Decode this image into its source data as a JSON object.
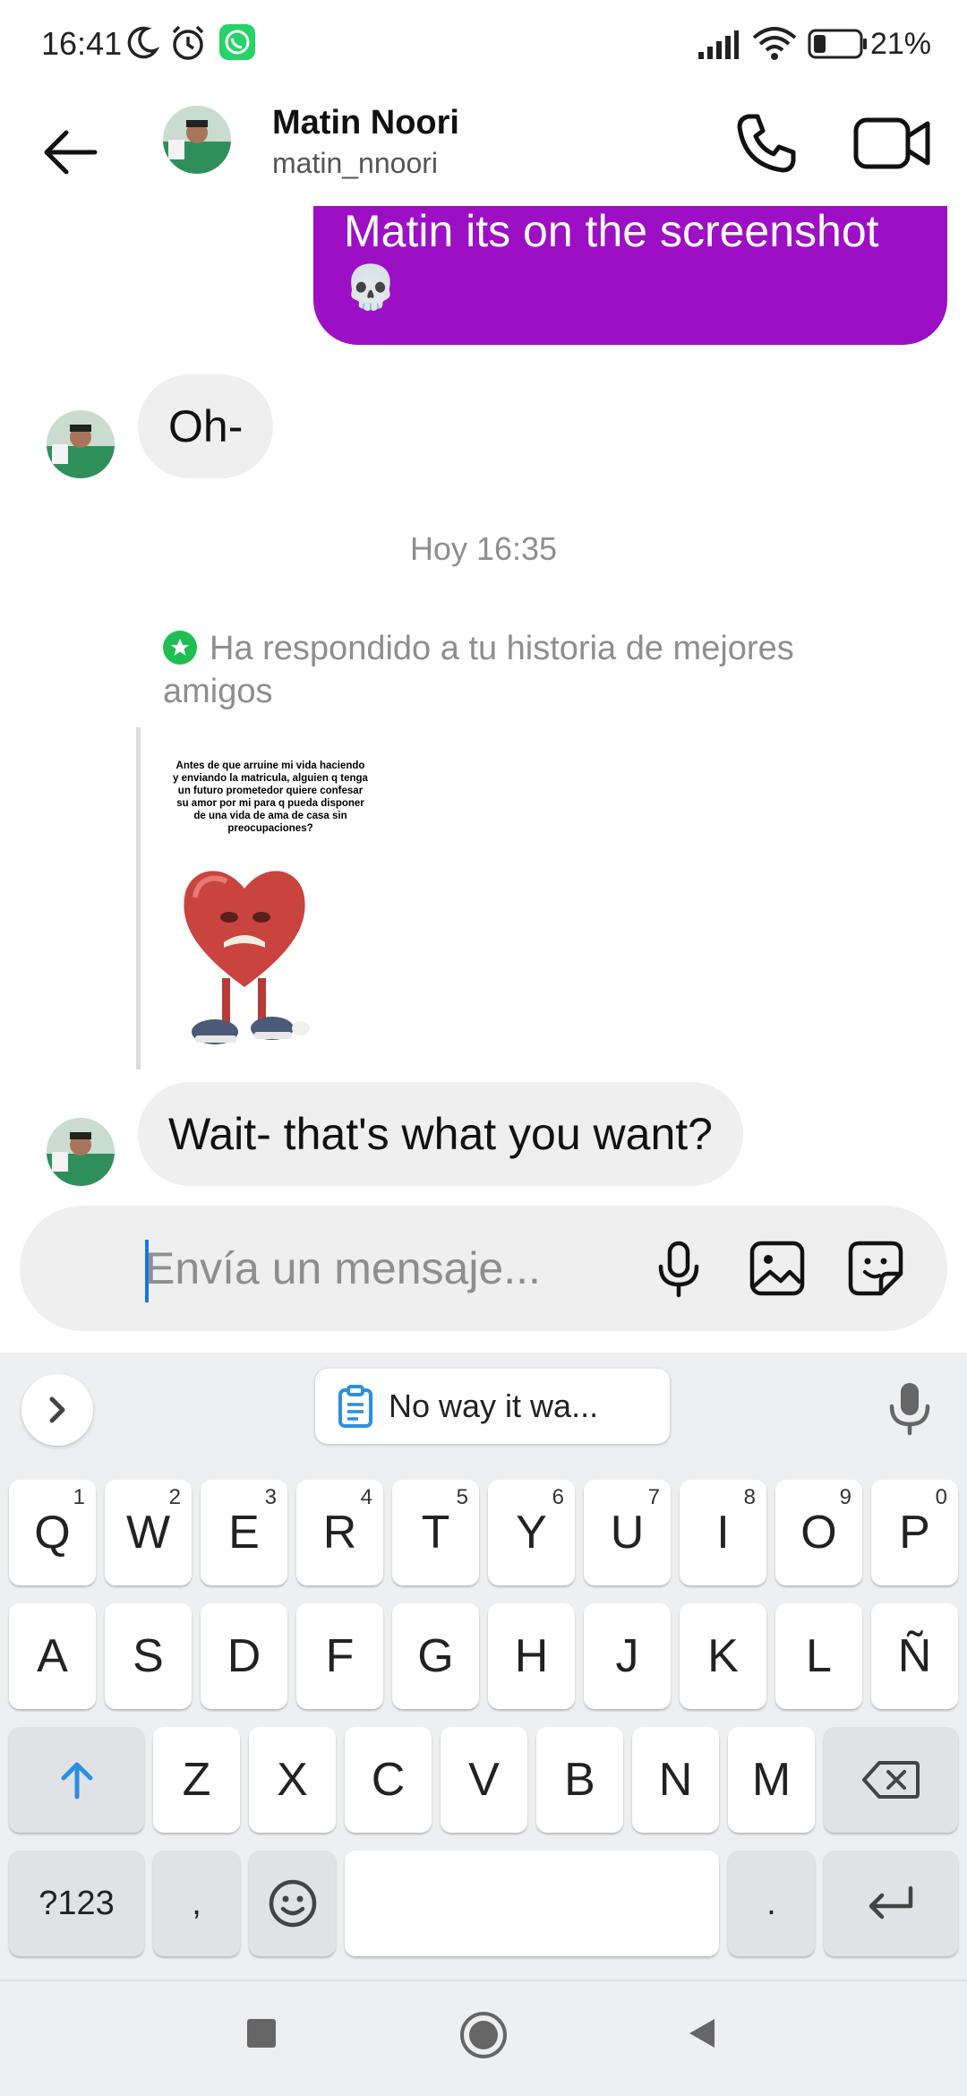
{
  "status_bar": {
    "time": "16:41",
    "icons": [
      "moon-icon",
      "alarm-icon",
      "whatsapp-icon",
      "signal-icon",
      "wifi-icon",
      "battery-icon"
    ],
    "battery_text": "21%",
    "whatsapp_color": "#25d366"
  },
  "header": {
    "contact_name": "Matin Noori",
    "contact_username": "matin_nnoori",
    "icons": [
      "back-arrow-icon",
      "phone-icon",
      "video-camera-icon"
    ]
  },
  "messages": [
    {
      "direction": "outgoing",
      "text": "Matin its on the screenshot",
      "emoji": "💀",
      "bubble_color": "#9d0fc5"
    },
    {
      "direction": "incoming",
      "text": "Oh-"
    },
    {
      "type": "timestamp",
      "text": "Hoy 16:35"
    },
    {
      "type": "story_reply",
      "note": "Ha respondido a tu historia de mejores amigos",
      "story_text": "Antes de que arruine mi vida haciendo y enviando la matricula, alguien q tenga un futuro prometedor quiere confesar su amor por mi para q pueda disponer de una vida de ama de casa sin preocupaciones?",
      "badge_color": "#1fbe52"
    },
    {
      "direction": "incoming",
      "text": "Wait- that's what you want?"
    }
  ],
  "composer": {
    "placeholder": "Envía un mensaje...",
    "icons": [
      "microphone-icon",
      "gallery-icon",
      "sticker-icon"
    ]
  },
  "keyboard": {
    "clipboard_suggestion": "No way it wa...",
    "row1": [
      {
        "label": "Q",
        "hint": "1"
      },
      {
        "label": "W",
        "hint": "2"
      },
      {
        "label": "E",
        "hint": "3"
      },
      {
        "label": "R",
        "hint": "4"
      },
      {
        "label": "T",
        "hint": "5"
      },
      {
        "label": "Y",
        "hint": "6"
      },
      {
        "label": "U",
        "hint": "7"
      },
      {
        "label": "I",
        "hint": "8"
      },
      {
        "label": "O",
        "hint": "9"
      },
      {
        "label": "P",
        "hint": "0"
      }
    ],
    "row2": [
      "A",
      "S",
      "D",
      "F",
      "G",
      "H",
      "J",
      "K",
      "L",
      "Ñ"
    ],
    "row3": [
      "Z",
      "X",
      "C",
      "V",
      "B",
      "N",
      "M"
    ],
    "symbols_label": "?123",
    "comma_label": ",",
    "period_label": ".",
    "accent_color": "#2c8fe0"
  },
  "nav_bar": {
    "icons": [
      "recents-square-icon",
      "home-circle-icon",
      "back-triangle-icon"
    ]
  }
}
